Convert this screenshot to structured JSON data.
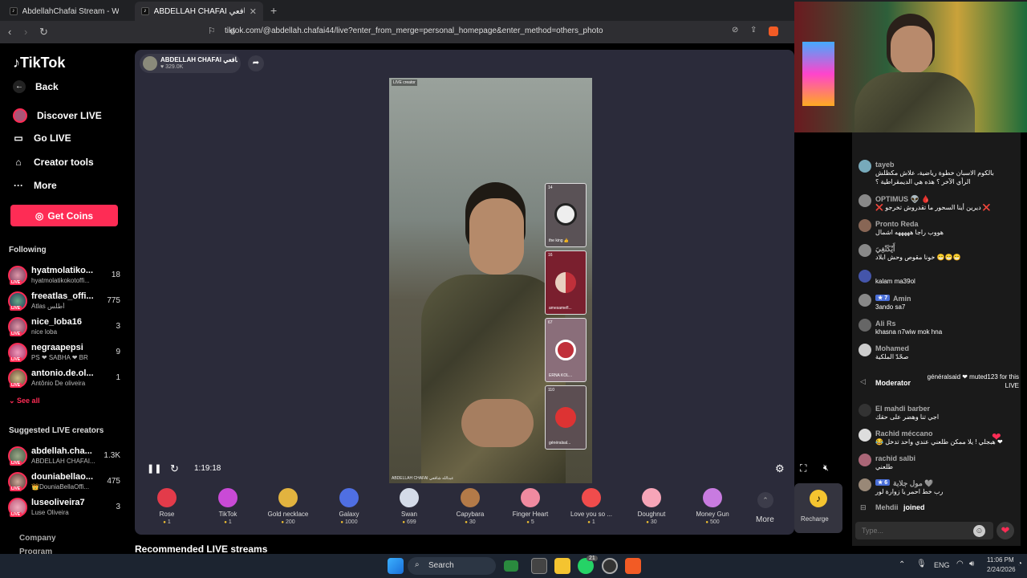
{
  "browser": {
    "tabs": [
      {
        "title": "AbdellahChafai Stream - Watch Live o"
      },
      {
        "title": "ABDELLAH CHAFAI عبدالله شافعي (@"
      }
    ],
    "new_tab": "+",
    "url": "tiktok.com/@abdellah.chafai44/live?enter_from_merge=personal_homepage&enter_method=others_photo"
  },
  "sidebar": {
    "logo": "TikTok",
    "back": "Back",
    "nav": [
      {
        "label": "Discover LIVE",
        "icon": "discover-live-icon"
      },
      {
        "label": "Go LIVE",
        "icon": "camera-icon"
      },
      {
        "label": "Creator tools",
        "icon": "home-icon"
      },
      {
        "label": "More",
        "icon": "ellipsis-icon"
      }
    ],
    "coins": "Get Coins",
    "following_title": "Following",
    "following": [
      {
        "name": "hyatmolatiko...",
        "sub": "hyatmolatikokotoffi...",
        "count": "18"
      },
      {
        "name": "freeatlas_offi...",
        "sub": "Atlas أطلس",
        "count": "775"
      },
      {
        "name": "nice_loba16",
        "sub": "nice loba",
        "count": "3"
      },
      {
        "name": "negraapepsi",
        "sub": "PS ❤ SABHA ❤ BR",
        "count": "9"
      },
      {
        "name": "antonio.de.ol...",
        "sub": "Antônio De oliveira",
        "count": "1"
      }
    ],
    "see_all": "See all",
    "suggested_title": "Suggested LIVE creators",
    "suggested": [
      {
        "name": "abdellah.cha...",
        "sub": "ABDELLAH CHAFAI...",
        "count": "1.3K"
      },
      {
        "name": "douniabellao...",
        "sub": "👑DouniaBellaOffi...",
        "count": "475"
      },
      {
        "name": "luseoliveira7",
        "sub": "Luse Oliveira",
        "count": "3"
      }
    ],
    "company": "Company",
    "program": "Program"
  },
  "player": {
    "host_name": "ABDELLAH CHAFAI عبدالله شافعي",
    "host_likes": "♥ 329.0K",
    "live_creator": "LIVE creator",
    "video_caption": "ABDELLAH CHAFAI عبدالله شافعي",
    "time": "1:19:18",
    "guests": [
      {
        "count": "14",
        "name": "the king 👍"
      },
      {
        "count": "16",
        "name": "amesamefl..."
      },
      {
        "count": "67",
        "name": "ERNA KOL..."
      },
      {
        "count": "110",
        "name": "généralsal..."
      }
    ]
  },
  "gifts": [
    {
      "name": "Rose",
      "price": "1",
      "color": "#e33b4a"
    },
    {
      "name": "TikTok",
      "price": "1",
      "color": "#c94ad6"
    },
    {
      "name": "Gold necklace",
      "price": "200",
      "color": "#e2b33f"
    },
    {
      "name": "Galaxy",
      "price": "1000",
      "color": "#4f6fe3"
    },
    {
      "name": "Swan",
      "price": "699",
      "color": "#d4dbe8"
    },
    {
      "name": "Capybara",
      "price": "30",
      "color": "#b37a48"
    },
    {
      "name": "Finger Heart",
      "price": "5",
      "color": "#f08aa0"
    },
    {
      "name": "Love you so ...",
      "price": "1",
      "color": "#f04c4c"
    },
    {
      "name": "Doughnut",
      "price": "30",
      "color": "#f6a5b8"
    },
    {
      "name": "Money Gun",
      "price": "500",
      "color": "#c87be0"
    }
  ],
  "gift_more": "More",
  "recharge": "Recharge",
  "recommended": "Recommended LIVE streams",
  "chat": {
    "messages": [
      {
        "name": "tayeb",
        "text": "بالكوم الاسبان خطوة رياضية، علاش مكظلش"
      },
      {
        "name": "",
        "text": "الرأي الآخر ؟ هذه هي الديمقراطية ؟"
      },
      {
        "name": "OPTIMUS 👽 🩸",
        "text": "❌ ديرين أينا السحور ما تقدروش تخرجو ❌"
      },
      {
        "name": "Pronto Reda",
        "text": "هووب راجا هههههه اشمال"
      },
      {
        "name": "أَيْكَنْغِيَ",
        "text": "خونا مقوص وحش ابلاد 😁😁😁"
      },
      {
        "name": "",
        "text": "kalam ma39ol"
      },
      {
        "name": "Amin",
        "text": "3ando sa7"
      },
      {
        "name": "Ali Rs",
        "text": "khasna n7wiw mok hna"
      },
      {
        "name": "Mohamed",
        "text": "صحّدّ الملكية"
      },
      {
        "name": "Moderator",
        "text": "généralsaid ❤ muted123 for this LIVE"
      },
      {
        "name": "El mahdi barber",
        "text": "اجي تنا وهضر على حقك"
      },
      {
        "name": "Rachid méccano",
        "text": "😂 هبجلي ! يلا ممكن طلعني عندي واحد تدخل ❤"
      },
      {
        "name": "rachid salbi",
        "text": "طلعني"
      },
      {
        "name": "مول جلابة 🩶",
        "text": "رب خط احمر يا زوارة لور"
      },
      {
        "name": "Mehdii",
        "text": "joined"
      }
    ],
    "badges": {
      "amin": "7",
      "ali": "6"
    },
    "placeholder": "Type..."
  },
  "taskbar": {
    "search": "Search",
    "lang": "ENG",
    "time": "11:06 PM",
    "date": "2/24/2026",
    "notif": "21"
  }
}
